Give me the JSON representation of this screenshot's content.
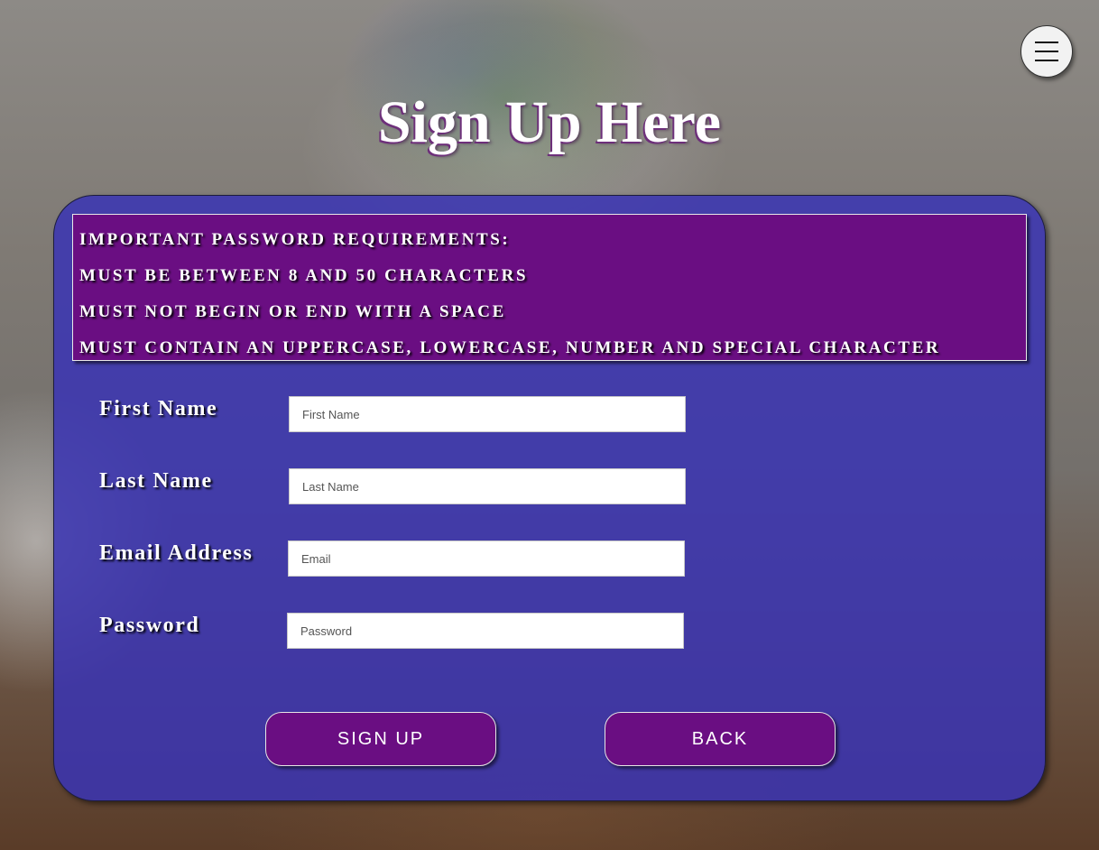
{
  "page": {
    "title": "Sign Up Here",
    "menu_icon": "hamburger-menu-icon"
  },
  "requirements": {
    "lines": [
      "IMPORTANT PASSWORD REQUIREMENTS:",
      "MUST BE BETWEEN 8 AND 50 CHARACTERS",
      "MUST NOT BEGIN OR END WITH A SPACE",
      "MUST CONTAIN AN UPPERCASE, LOWERCASE, NUMBER AND SPECIAL CHARACTER"
    ]
  },
  "form": {
    "fields": [
      {
        "label": "First Name",
        "placeholder": "First Name",
        "value": ""
      },
      {
        "label": "Last Name",
        "placeholder": "Last Name",
        "value": ""
      },
      {
        "label": "Email Address",
        "placeholder": "Email",
        "value": ""
      },
      {
        "label": "Password",
        "placeholder": "Password",
        "value": ""
      }
    ],
    "buttons": {
      "sign_up": "SIGN UP",
      "back": "BACK"
    }
  },
  "colors": {
    "panel": "#3a34b4",
    "accent_purple": "#6a0e82",
    "text": "#ffffff"
  }
}
